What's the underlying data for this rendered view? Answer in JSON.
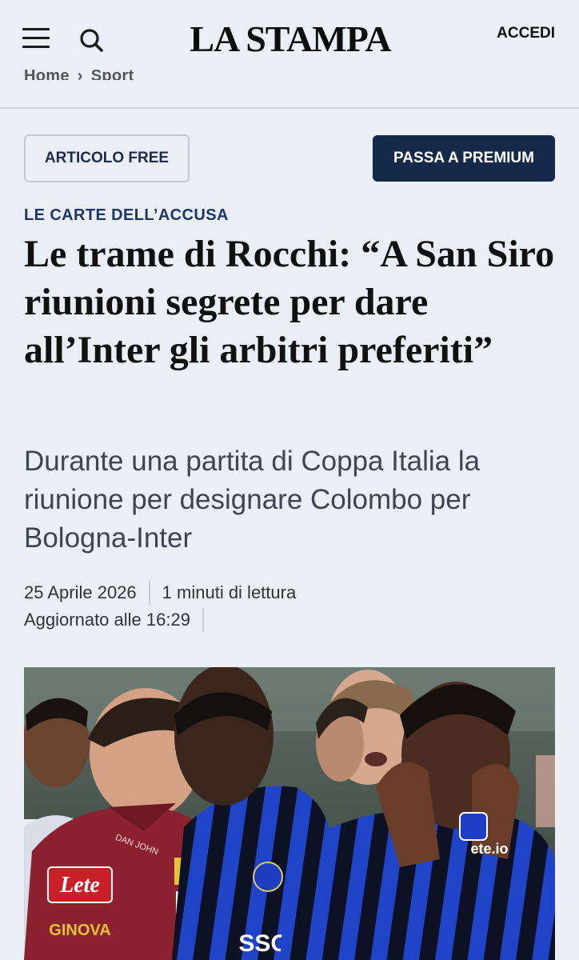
{
  "header": {
    "logo": "LA STAMPA",
    "login_label": "ACCEDI",
    "menu_icon": "hamburger-menu-icon",
    "search_icon": "search-icon"
  },
  "breadcrumb": {
    "items": [
      "Home",
      "Sport"
    ],
    "separator": "›"
  },
  "badges": {
    "free_label": "ARTICOLO FREE",
    "premium_label": "PASSA A PREMIUM"
  },
  "article": {
    "kicker": "LE CARTE DELL’ACCUSA",
    "headline": "Le trame di Rocchi: “A San Siro riunioni segrete per dare all’Inter gli arbitri preferiti”",
    "subtitle": "Durante una partita di Coppa Italia la riunione per designare Colombo per Bologna-Inter",
    "date": "25 Aprile 2026",
    "read_time": "1 minuti di lettura",
    "updated": "Aggiornato alle 16:29"
  },
  "photo": {
    "sponsor_lete": "Lete",
    "sponsor_ginova": "GINOVA",
    "sponsor_danjohn": "DAN JOHN",
    "sponsor_betsson": "ete.io",
    "sponsor_sso": "SSO"
  },
  "colors": {
    "background": "#ebeef5",
    "premium_button": "#152a4a",
    "kicker": "#1f3566",
    "referee_shirt": "#8c2230",
    "inter_blue": "#1d3fbf"
  }
}
